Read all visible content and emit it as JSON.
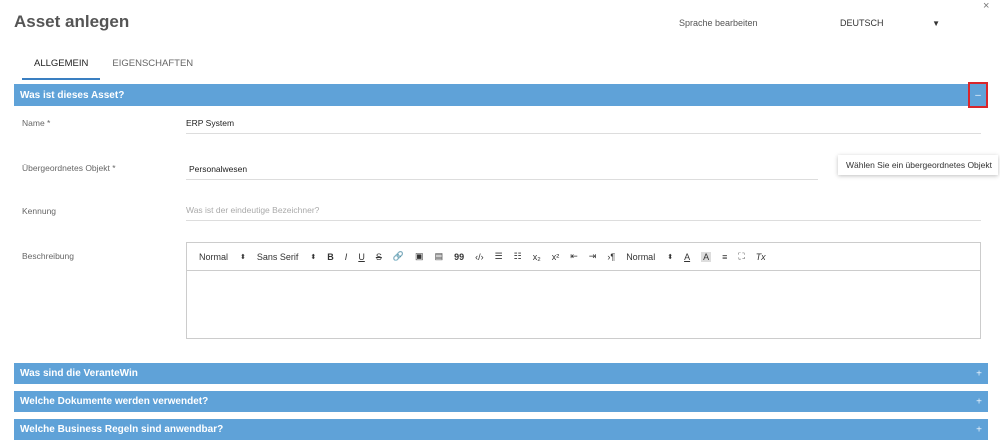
{
  "header": {
    "title": "Asset anlegen",
    "language_label": "Sprache bearbeiten",
    "language_value": "DEUTSCH",
    "close_symbol": "×"
  },
  "tabs": [
    {
      "label": "ALLGEMEIN",
      "active": true
    },
    {
      "label": "EIGENSCHAFTEN",
      "active": false
    }
  ],
  "sections": {
    "what": {
      "title": "Was ist dieses Asset?",
      "toggle": "–",
      "expanded": true
    },
    "responsible": {
      "title": "Was sind die VeranteWin",
      "toggle": "+"
    },
    "documents": {
      "title": "Welche Dokumente werden verwendet?",
      "toggle": "+"
    },
    "rules": {
      "title": "Welche Business Regeln sind anwendbar?",
      "toggle": "+"
    }
  },
  "fields": {
    "name": {
      "label": "Name *",
      "value": "ERP System"
    },
    "parent": {
      "label": "Übergeordnetes Objekt  *",
      "value": "Personalwesen"
    },
    "identifier": {
      "label": "Kennung",
      "placeholder": "Was ist der eindeutige Bezeichner?"
    },
    "description": {
      "label": "Beschreibung"
    }
  },
  "tooltip": "Wählen Sie ein übergeordnetes Objekt",
  "editor_toolbar": {
    "heading_select": "Normal",
    "font_select": "Sans Serif",
    "size_select": "Normal",
    "select_caret": "⬍",
    "bold": "B",
    "italic": "I",
    "underline": "U",
    "strike": "S",
    "link": "🔗",
    "image": "▣",
    "video": "▤",
    "blockquote": "99",
    "code": "‹/›",
    "ordered_list": "☰",
    "bullet_list": "☷",
    "subscript": "x₂",
    "superscript": "x²",
    "indent_less": "⇤",
    "indent_more": "⇥",
    "direction": "›¶",
    "text_color": "A",
    "background_color": "A",
    "align": "≡",
    "fullscreen": "⛶",
    "clear_format": "Tx"
  }
}
